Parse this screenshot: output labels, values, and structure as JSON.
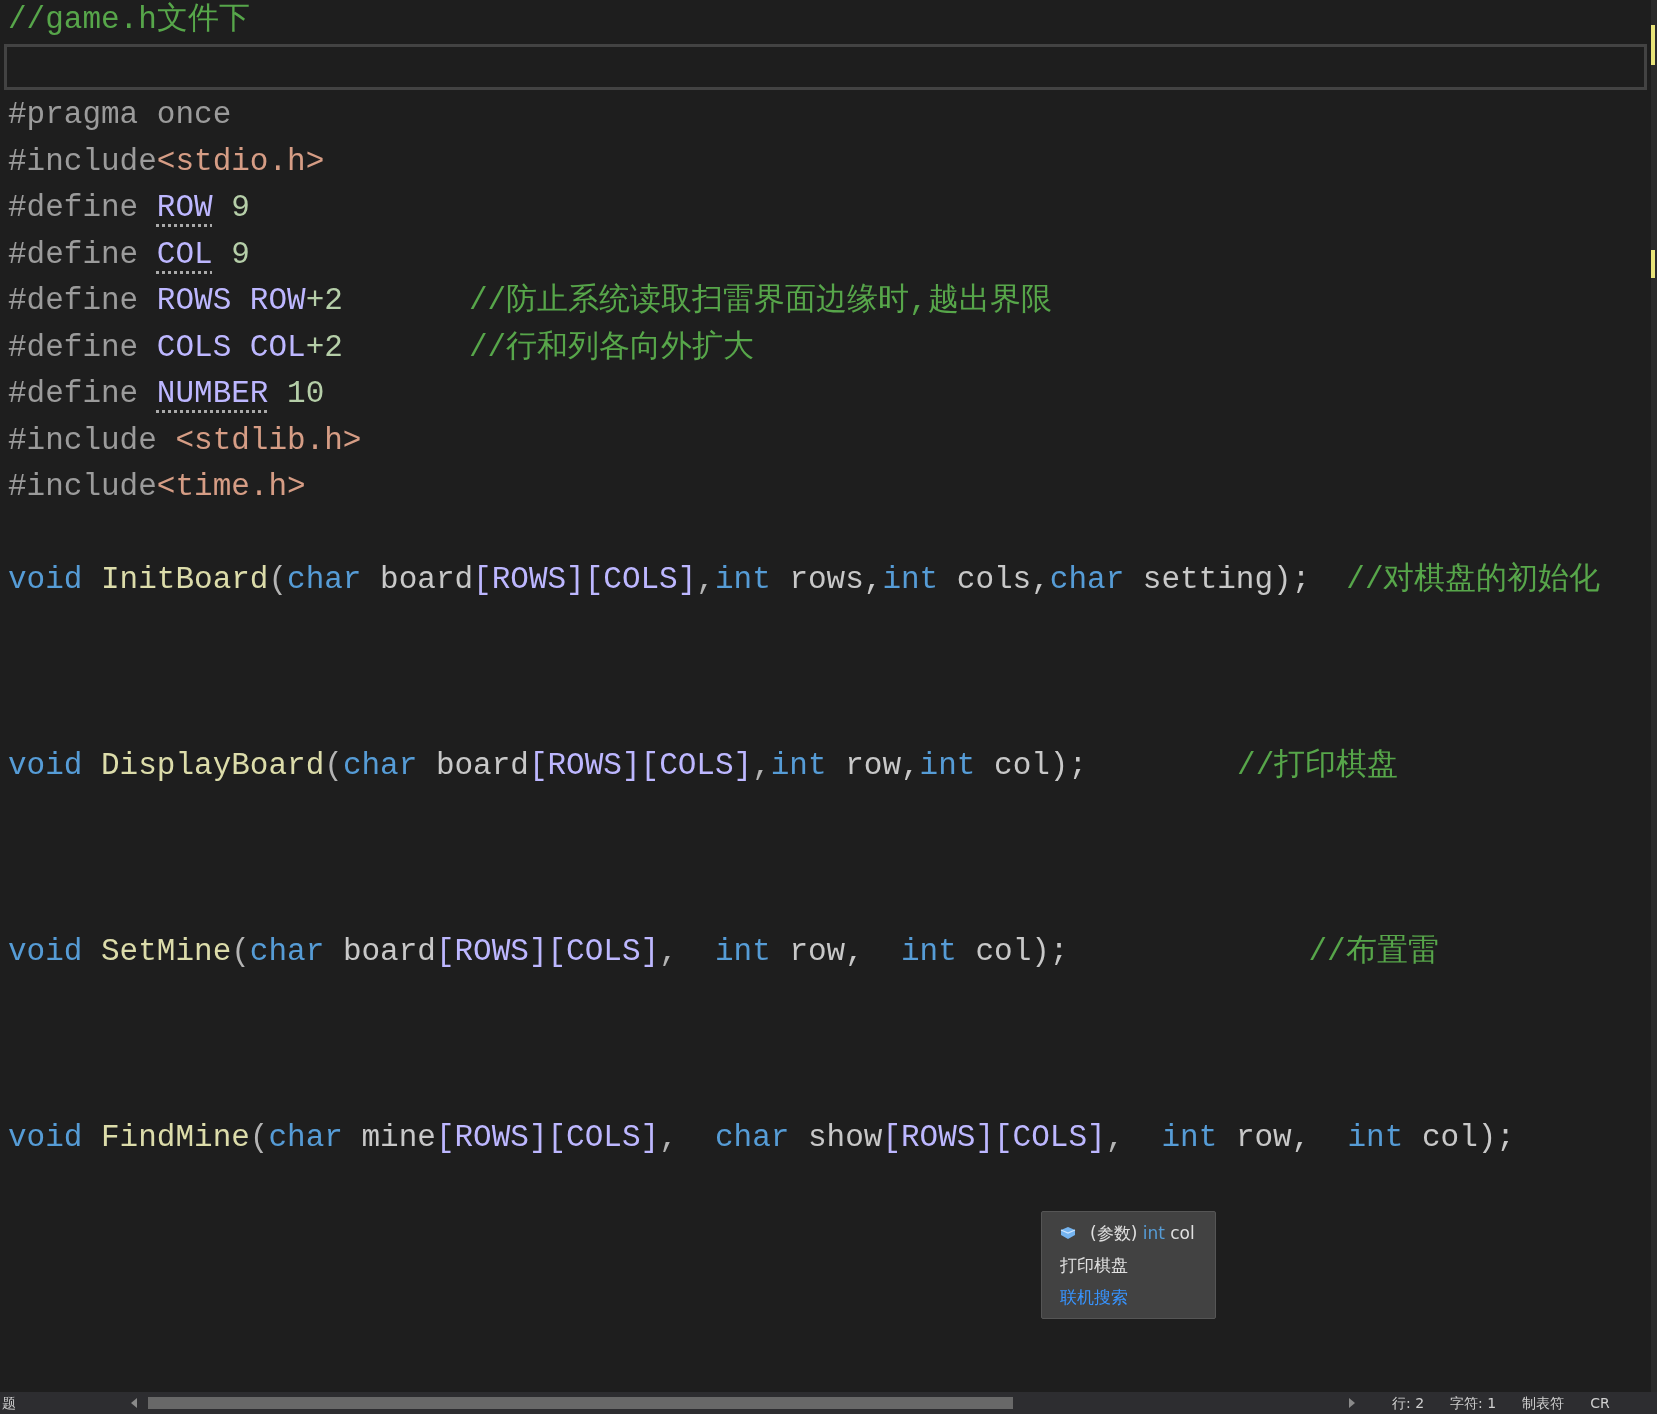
{
  "header_comment": "//game.h文件下",
  "lines": [
    {
      "kind": "code",
      "tokens": [
        {
          "kind": "pre",
          "text": "#pragma once"
        }
      ]
    },
    {
      "kind": "code",
      "tokens": [
        {
          "kind": "pre",
          "text": "#include"
        },
        {
          "kind": "str",
          "text": "<stdio.h>"
        }
      ]
    },
    {
      "kind": "code",
      "tokens": [
        {
          "kind": "pre",
          "text": "#define "
        },
        {
          "kind": "macro",
          "text": "ROW",
          "hint": true
        },
        {
          "kind": "num",
          "text": " 9"
        }
      ]
    },
    {
      "kind": "code",
      "tokens": [
        {
          "kind": "pre",
          "text": "#define "
        },
        {
          "kind": "macro",
          "text": "COL",
          "hint": true
        },
        {
          "kind": "num",
          "text": " 9"
        }
      ]
    },
    {
      "kind": "code",
      "tokens": [
        {
          "kind": "pre",
          "text": "#define "
        },
        {
          "kind": "macro",
          "text": "ROWS ROW"
        },
        {
          "kind": "num",
          "text": "+2"
        }
      ],
      "comment": "//防止系统读取扫雷界面边缘时,越出界限"
    },
    {
      "kind": "code",
      "tokens": [
        {
          "kind": "pre",
          "text": "#define "
        },
        {
          "kind": "macro",
          "text": "COLS COL"
        },
        {
          "kind": "num",
          "text": "+2"
        }
      ],
      "comment": "//行和列各向外扩大"
    },
    {
      "kind": "code",
      "tokens": [
        {
          "kind": "pre",
          "text": "#define "
        },
        {
          "kind": "macro",
          "text": "NUMBER",
          "hint": true
        },
        {
          "kind": "num",
          "text": " 10"
        }
      ]
    },
    {
      "kind": "code",
      "tokens": [
        {
          "kind": "pre",
          "text": "#include "
        },
        {
          "kind": "str",
          "text": "<stdlib.h>"
        }
      ]
    },
    {
      "kind": "code",
      "tokens": [
        {
          "kind": "pre",
          "text": "#include"
        },
        {
          "kind": "str",
          "text": "<time.h>"
        }
      ]
    },
    {
      "kind": "blank"
    },
    {
      "kind": "code",
      "tokens": [
        {
          "kind": "kw",
          "text": "void "
        },
        {
          "kind": "fn",
          "text": "InitBoard"
        },
        {
          "kind": "punc",
          "text": "("
        },
        {
          "kind": "kw",
          "text": "char "
        },
        {
          "kind": "id",
          "text": "board"
        },
        {
          "kind": "macro",
          "text": "[ROWS][COLS]"
        },
        {
          "kind": "punc",
          "text": ","
        },
        {
          "kind": "kw",
          "text": "int "
        },
        {
          "kind": "id",
          "text": "rows,"
        },
        {
          "kind": "kw",
          "text": "int "
        },
        {
          "kind": "id",
          "text": "cols,"
        },
        {
          "kind": "kw",
          "text": "char "
        },
        {
          "kind": "id",
          "text": "setting);"
        }
      ],
      "comment": "//对棋盘的初始化"
    },
    {
      "kind": "blank"
    },
    {
      "kind": "blank"
    },
    {
      "kind": "blank"
    },
    {
      "kind": "code",
      "tokens": [
        {
          "kind": "kw",
          "text": "void "
        },
        {
          "kind": "fn",
          "text": "DisplayBoard"
        },
        {
          "kind": "punc",
          "text": "("
        },
        {
          "kind": "kw",
          "text": "char "
        },
        {
          "kind": "id",
          "text": "board"
        },
        {
          "kind": "macro",
          "text": "[ROWS][COLS]"
        },
        {
          "kind": "punc",
          "text": ","
        },
        {
          "kind": "kw",
          "text": "int "
        },
        {
          "kind": "id",
          "text": "row,"
        },
        {
          "kind": "kw",
          "text": "int "
        },
        {
          "kind": "id",
          "text": "col);"
        }
      ],
      "comment": "//打印棋盘"
    },
    {
      "kind": "blank"
    },
    {
      "kind": "blank"
    },
    {
      "kind": "blank"
    },
    {
      "kind": "code",
      "tokens": [
        {
          "kind": "kw",
          "text": "void "
        },
        {
          "kind": "fn",
          "text": "SetMine"
        },
        {
          "kind": "punc",
          "text": "("
        },
        {
          "kind": "kw",
          "text": "char "
        },
        {
          "kind": "id",
          "text": "board"
        },
        {
          "kind": "macro",
          "text": "[ROWS][COLS]"
        },
        {
          "kind": "punc",
          "text": ",  "
        },
        {
          "kind": "kw",
          "text": "int "
        },
        {
          "kind": "id",
          "text": "row,  "
        },
        {
          "kind": "kw",
          "text": "int "
        },
        {
          "kind": "id",
          "text": "col);"
        }
      ],
      "comment": "//布置雷"
    },
    {
      "kind": "blank"
    },
    {
      "kind": "blank"
    },
    {
      "kind": "blank"
    },
    {
      "kind": "code",
      "tokens": [
        {
          "kind": "kw",
          "text": "void "
        },
        {
          "kind": "fn",
          "text": "FindMine"
        },
        {
          "kind": "punc",
          "text": "("
        },
        {
          "kind": "kw",
          "text": "char "
        },
        {
          "kind": "id",
          "text": "mine"
        },
        {
          "kind": "macro",
          "text": "[ROWS][COLS]"
        },
        {
          "kind": "punc",
          "text": ",  "
        },
        {
          "kind": "kw",
          "text": "char "
        },
        {
          "kind": "id",
          "text": "show"
        },
        {
          "kind": "macro",
          "text": "[ROWS][COLS]"
        },
        {
          "kind": "punc",
          "text": ",  "
        },
        {
          "kind": "kw",
          "text": "int "
        },
        {
          "kind": "id",
          "text": "row,  "
        },
        {
          "kind": "kw",
          "text": "int "
        },
        {
          "kind": "id",
          "text": "col);"
        }
      ]
    }
  ],
  "tooltip": {
    "prefix": "(参数)",
    "type": "int",
    "name": "col",
    "description": "打印棋盘",
    "link": "联机搜索"
  },
  "status_bar": {
    "left": "题",
    "items": [
      "行: 2",
      "字符: 1",
      "制表符",
      "CR"
    ]
  }
}
